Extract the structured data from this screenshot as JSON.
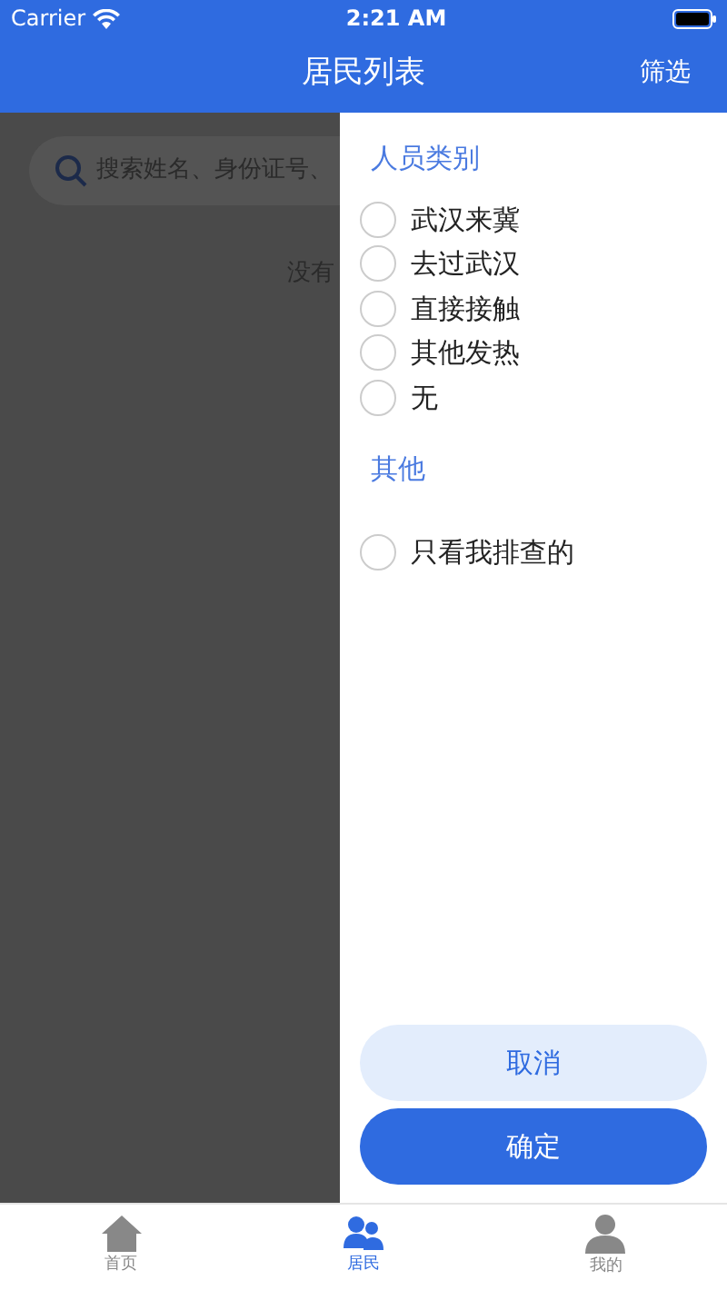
{
  "status_bar": {
    "carrier": "Carrier",
    "time": "2:21 AM"
  },
  "nav": {
    "title": "居民列表",
    "action": "筛选"
  },
  "background": {
    "search": {
      "placeholder": "搜索姓名、身份证号、"
    },
    "empty_text": "没有"
  },
  "filter_drawer": {
    "sections": [
      {
        "title": "人员类别",
        "options": [
          {
            "label": "武汉来冀",
            "checked": false
          },
          {
            "label": "去过武汉",
            "checked": false
          },
          {
            "label": "直接接触",
            "checked": false
          },
          {
            "label": "其他发热",
            "checked": false
          },
          {
            "label": "无",
            "checked": false
          }
        ]
      },
      {
        "title": "其他",
        "options": [
          {
            "label": "只看我排查的",
            "checked": false
          }
        ]
      }
    ],
    "buttons": [
      {
        "label": "取消",
        "kind": "secondary"
      },
      {
        "label": "确定",
        "kind": "primary"
      }
    ]
  },
  "tab_bar": [
    {
      "label": "首页",
      "selected": false
    },
    {
      "label": "居民",
      "selected": true
    },
    {
      "label": "我的",
      "selected": false
    }
  ]
}
